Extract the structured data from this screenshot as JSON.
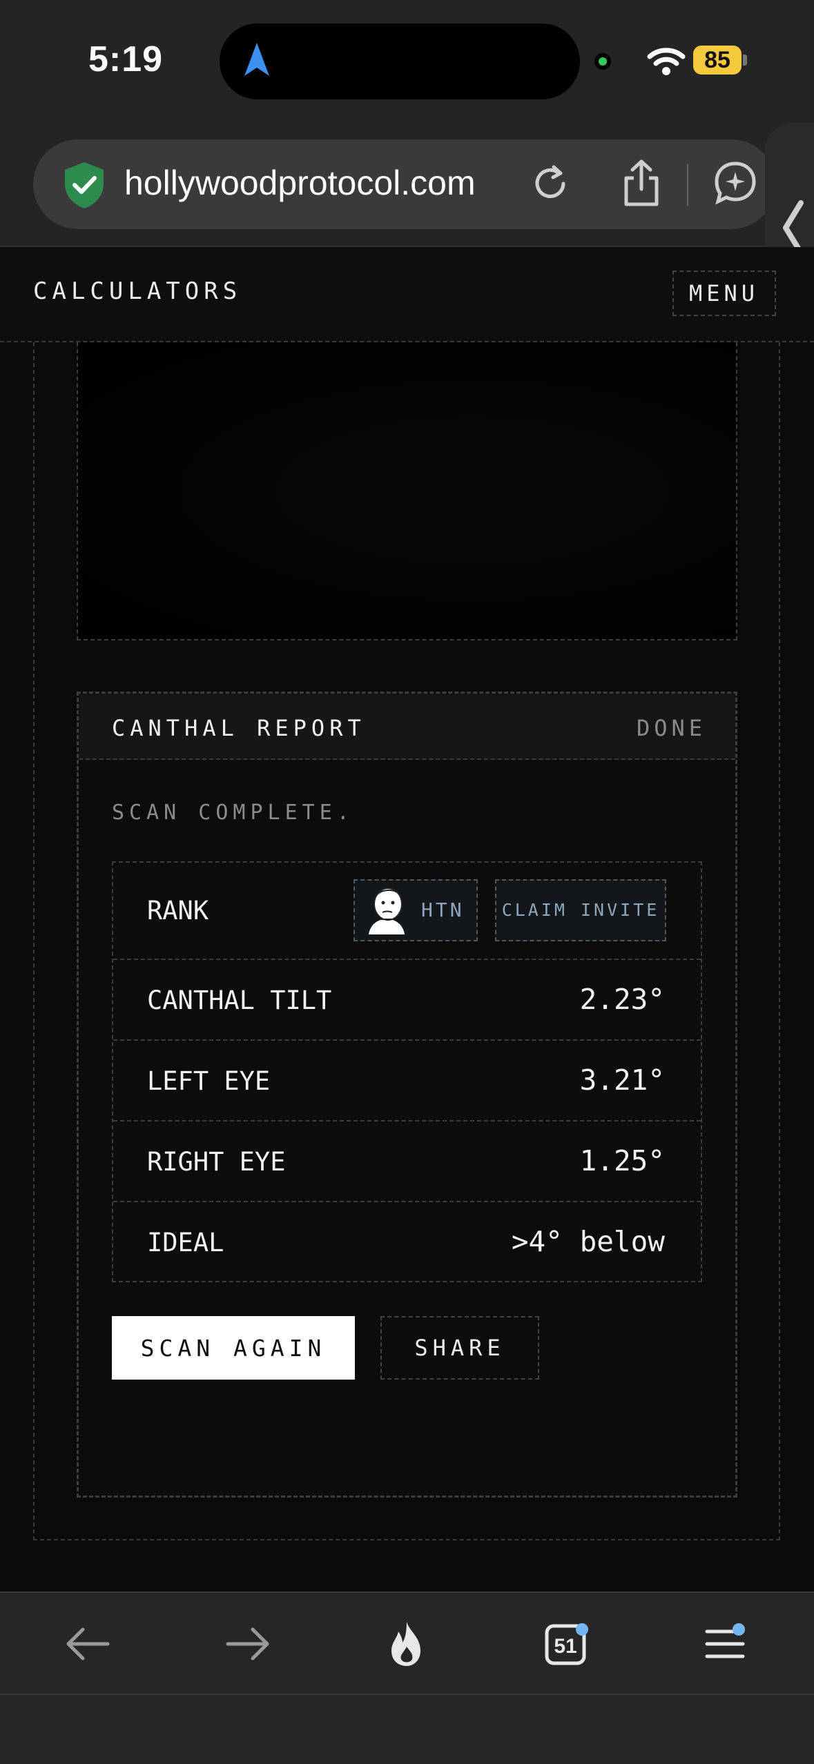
{
  "status_bar": {
    "time": "5:19",
    "battery": "85"
  },
  "browser": {
    "url": "hollywoodprotocol.com",
    "tab_count": "51"
  },
  "site": {
    "title": "CALCULATORS",
    "menu_label": "MENU"
  },
  "report": {
    "title": "CANTHAL REPORT",
    "done_label": "DONE",
    "status": "SCAN COMPLETE.",
    "rank": {
      "label": "RANK",
      "badge": "HTN",
      "claim_label": "CLAIM INVITE"
    },
    "metrics": [
      {
        "label": "CANTHAL TILT",
        "value": "2.23°"
      },
      {
        "label": "LEFT EYE",
        "value": "3.21°"
      },
      {
        "label": "RIGHT EYE",
        "value": "1.25°"
      },
      {
        "label": "IDEAL",
        "value": ">4° below"
      }
    ],
    "scan_again_label": "SCAN AGAIN",
    "share_label": "SHARE"
  },
  "colors": {
    "background": "#0a0a0a",
    "accent_badge": "#8da6c0",
    "battery": "#f5c93e",
    "camera_indicator": "#35c759",
    "shield": "#2e8b4e",
    "notification_dot": "#74b6f2"
  }
}
